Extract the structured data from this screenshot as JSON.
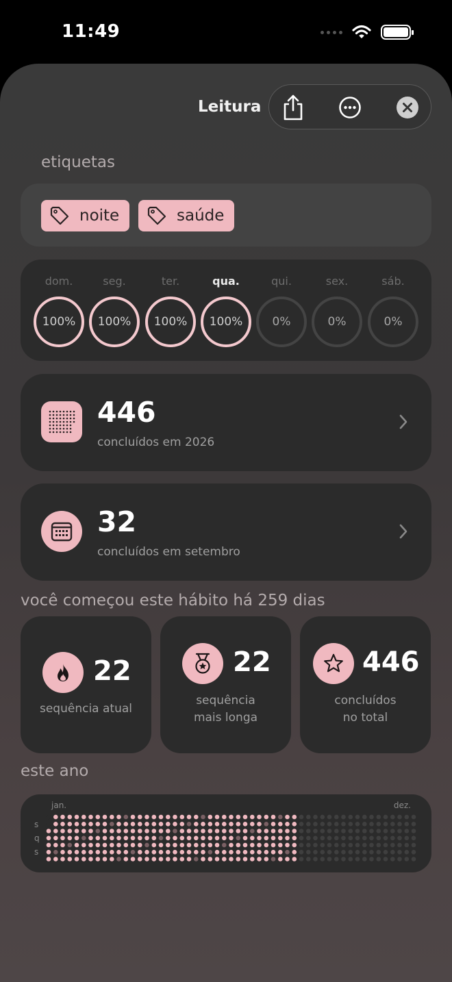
{
  "status_bar": {
    "time": "11:49"
  },
  "header": {
    "title": "Leitura"
  },
  "tags": {
    "label": "etiquetas",
    "items": [
      "noite",
      "saúde"
    ]
  },
  "week": {
    "days": [
      {
        "label": "dom.",
        "value": "100%",
        "done": true
      },
      {
        "label": "seg.",
        "value": "100%",
        "done": true
      },
      {
        "label": "ter.",
        "value": "100%",
        "done": true
      },
      {
        "label": "qua.",
        "value": "100%",
        "done": true,
        "today": true
      },
      {
        "label": "qui.",
        "value": "0%",
        "done": false
      },
      {
        "label": "sex.",
        "value": "0%",
        "done": false
      },
      {
        "label": "sáb.",
        "value": "0%",
        "done": false
      }
    ]
  },
  "year_stat": {
    "value": "446",
    "caption": "concluídos em 2026"
  },
  "month_stat": {
    "value": "32",
    "caption": "concluídos em setembro"
  },
  "since_text": "você começou este hábito há 259 dias",
  "streaks": {
    "current": {
      "value": "22",
      "caption": "sequência atual"
    },
    "longest": {
      "value": "22",
      "caption_line1": "sequência",
      "caption_line2": "mais longa"
    },
    "total": {
      "value": "446",
      "caption_line1": "concluídos",
      "caption_line2": "no total"
    }
  },
  "this_year": {
    "label": "este ano",
    "month_start": "jan.",
    "month_end": "dez.",
    "day_labels": [
      "s",
      "q",
      "s"
    ]
  },
  "colors": {
    "accent": "#f0b9c0",
    "card": "#2b2b2b",
    "ring_done": "#f4c9ce",
    "dot_off": "#3f3f3f"
  }
}
